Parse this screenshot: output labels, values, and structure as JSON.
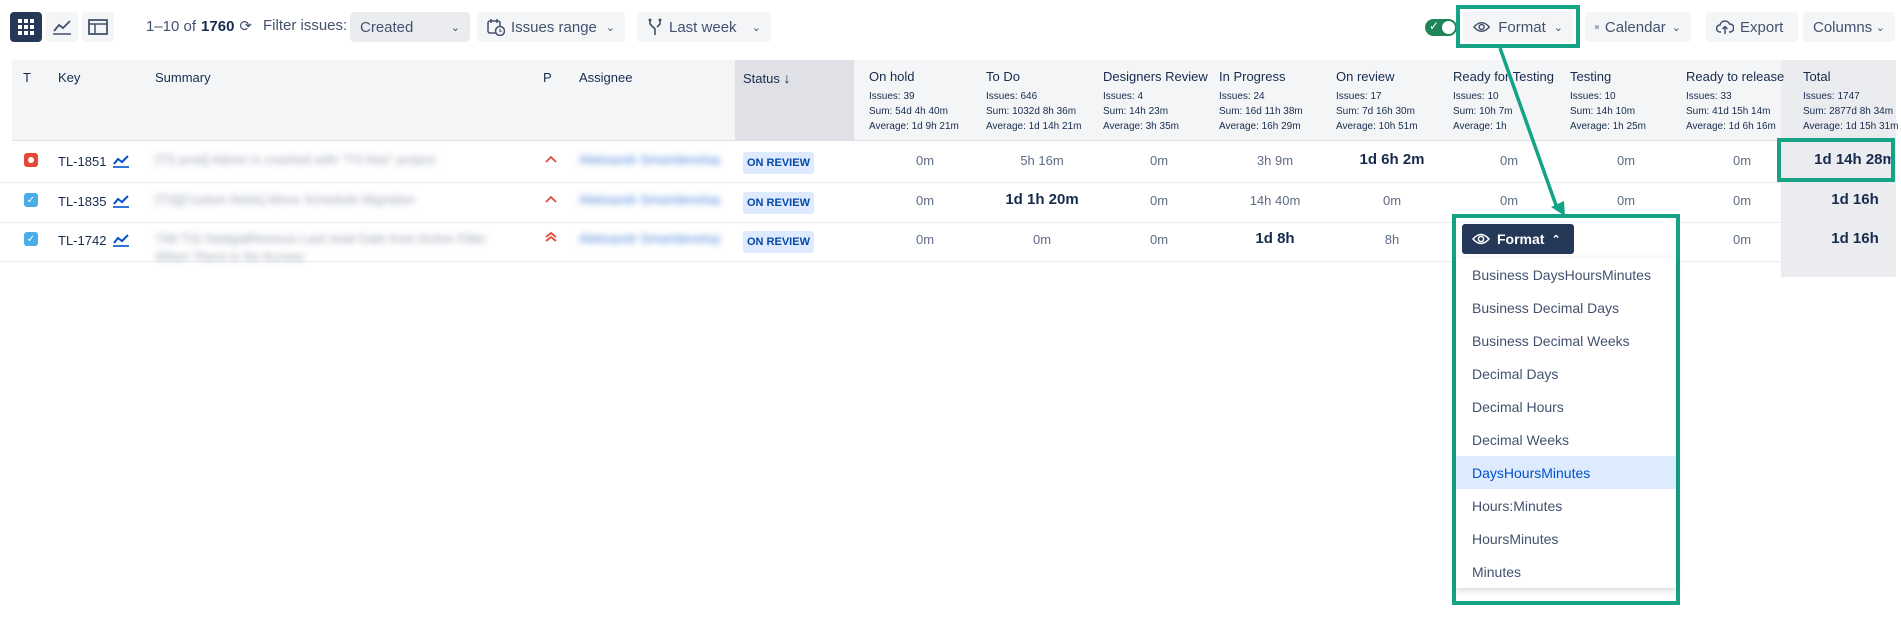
{
  "toolbar": {
    "pager_range": "1–10 of",
    "pager_total": "1760",
    "filter_label": "Filter issues:",
    "filter_value": "Created",
    "issues_range_label": "Issues range",
    "period_label": "Last week",
    "format_label": "Format",
    "calendar_label": "Calendar",
    "export_label": "Export",
    "columns_label": "Columns"
  },
  "columns": {
    "type": "T",
    "key": "Key",
    "summary": "Summary",
    "priority": "P",
    "assignee": "Assignee",
    "status": "Status"
  },
  "stat_columns": [
    {
      "title": "On hold",
      "issues": "Issues: 39",
      "sum": "Sum: 54d 4h 40m",
      "avg": "Average: 1d 9h 21m"
    },
    {
      "title": "To Do",
      "issues": "Issues: 646",
      "sum": "Sum: 1032d 8h 36m",
      "avg": "Average: 1d 14h 21m"
    },
    {
      "title": "Designers Review",
      "issues": "Issues: 4",
      "sum": "Sum: 14h 23m",
      "avg": "Average: 3h 35m"
    },
    {
      "title": "In Progress",
      "issues": "Issues: 24",
      "sum": "Sum: 16d 11h 38m",
      "avg": "Average: 16h 29m"
    },
    {
      "title": "On review",
      "issues": "Issues: 17",
      "sum": "Sum: 7d 16h 30m",
      "avg": "Average: 10h 51m"
    },
    {
      "title": "Ready for Testing",
      "issues": "Issues: 10",
      "sum": "Sum: 10h 7m",
      "avg": "Average: 1h"
    },
    {
      "title": "Testing",
      "issues": "Issues: 10",
      "sum": "Sum: 14h 10m",
      "avg": "Average: 1h 25m"
    },
    {
      "title": "Ready to release",
      "issues": "Issues: 33",
      "sum": "Sum: 41d 15h 14m",
      "avg": "Average: 1d 6h 16m"
    },
    {
      "title": "Total",
      "issues": "Issues: 1747",
      "sum": "Sum: 2877d 8h 34m",
      "avg": "Average: 1d 15h 31m"
    }
  ],
  "rows": [
    {
      "key": "TL-1851",
      "type": "bug",
      "summary": "[TS prod] Admin is crashed with \"TS lists\" project",
      "priority": "high",
      "assignee": "Aleksandr Smartdevelop",
      "status": "ON REVIEW",
      "values": [
        "0m",
        "5h 16m",
        "0m",
        "3h 9m",
        "1d 6h 2m",
        "0m",
        "0m",
        "0m"
      ],
      "total": "1d 14h 28m"
    },
    {
      "key": "TL-1835",
      "type": "task",
      "summary": "[TS][Custom fields] Move Schedule Migration",
      "priority": "high",
      "assignee": "Aleksandr Smartdevelop",
      "status": "ON REVIEW",
      "values": [
        "0m",
        "1d 1h 20m",
        "0m",
        "14h 40m",
        "0m",
        "0m",
        "0m",
        "0m"
      ],
      "total": "1d 16h"
    },
    {
      "key": "TL-1742",
      "type": "task",
      "summary": "TIM TIS StatigatRemove Last read Date from Active Filter",
      "summary2": "When There is No Access",
      "priority": "highest",
      "assignee": "Aleksandr Smartdevelop",
      "status": "ON REVIEW",
      "values": [
        "0m",
        "0m",
        "0m",
        "1d 8h",
        "8h",
        "",
        "",
        "0m"
      ],
      "total": "1d 16h"
    }
  ],
  "format_menu": {
    "label": "Format",
    "options": [
      "Business DaysHoursMinutes",
      "Business Decimal Days",
      "Business Decimal Weeks",
      "Decimal Days",
      "Decimal Hours",
      "Decimal Weeks",
      "DaysHoursMinutes",
      "Hours:Minutes",
      "HoursMinutes",
      "Minutes"
    ],
    "selected": "DaysHoursMinutes"
  },
  "colors": {
    "highlight": "#14a384",
    "badge_bg": "#deebff",
    "badge_text": "#0747a6",
    "bug": "#e5493a",
    "task": "#4bade8"
  }
}
